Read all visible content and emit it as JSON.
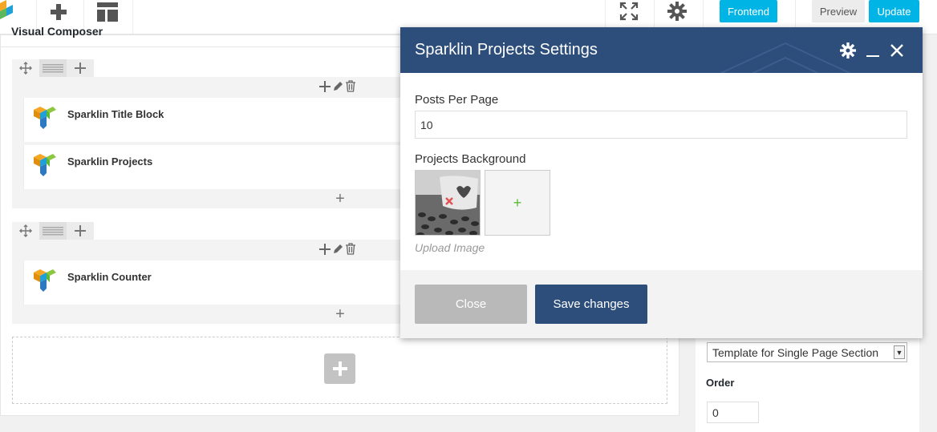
{
  "toolbar": {
    "frontend_label": "Frontend",
    "preview_label": "Preview",
    "update_label": "Update",
    "accent_color": "#00b4e6"
  },
  "editor": {
    "title": "Visual Composer",
    "rows": [
      {
        "elements": [
          "Sparklin Title Block",
          "Sparklin Projects"
        ]
      },
      {
        "elements": [
          "Sparklin Counter"
        ]
      }
    ],
    "add_symbol": "+"
  },
  "modal": {
    "title": "Sparklin Projects Settings",
    "header_color": "#2d4e7b",
    "posts_per_page_label": "Posts Per Page",
    "posts_per_page_value": "10",
    "background_label": "Projects Background",
    "upload_hint": "Upload Image",
    "add_image_symbol": "+",
    "close_label": "Close",
    "save_label": "Save changes"
  },
  "side": {
    "template_value": "Template for Single Page Section",
    "order_label": "Order",
    "order_value": "0"
  }
}
